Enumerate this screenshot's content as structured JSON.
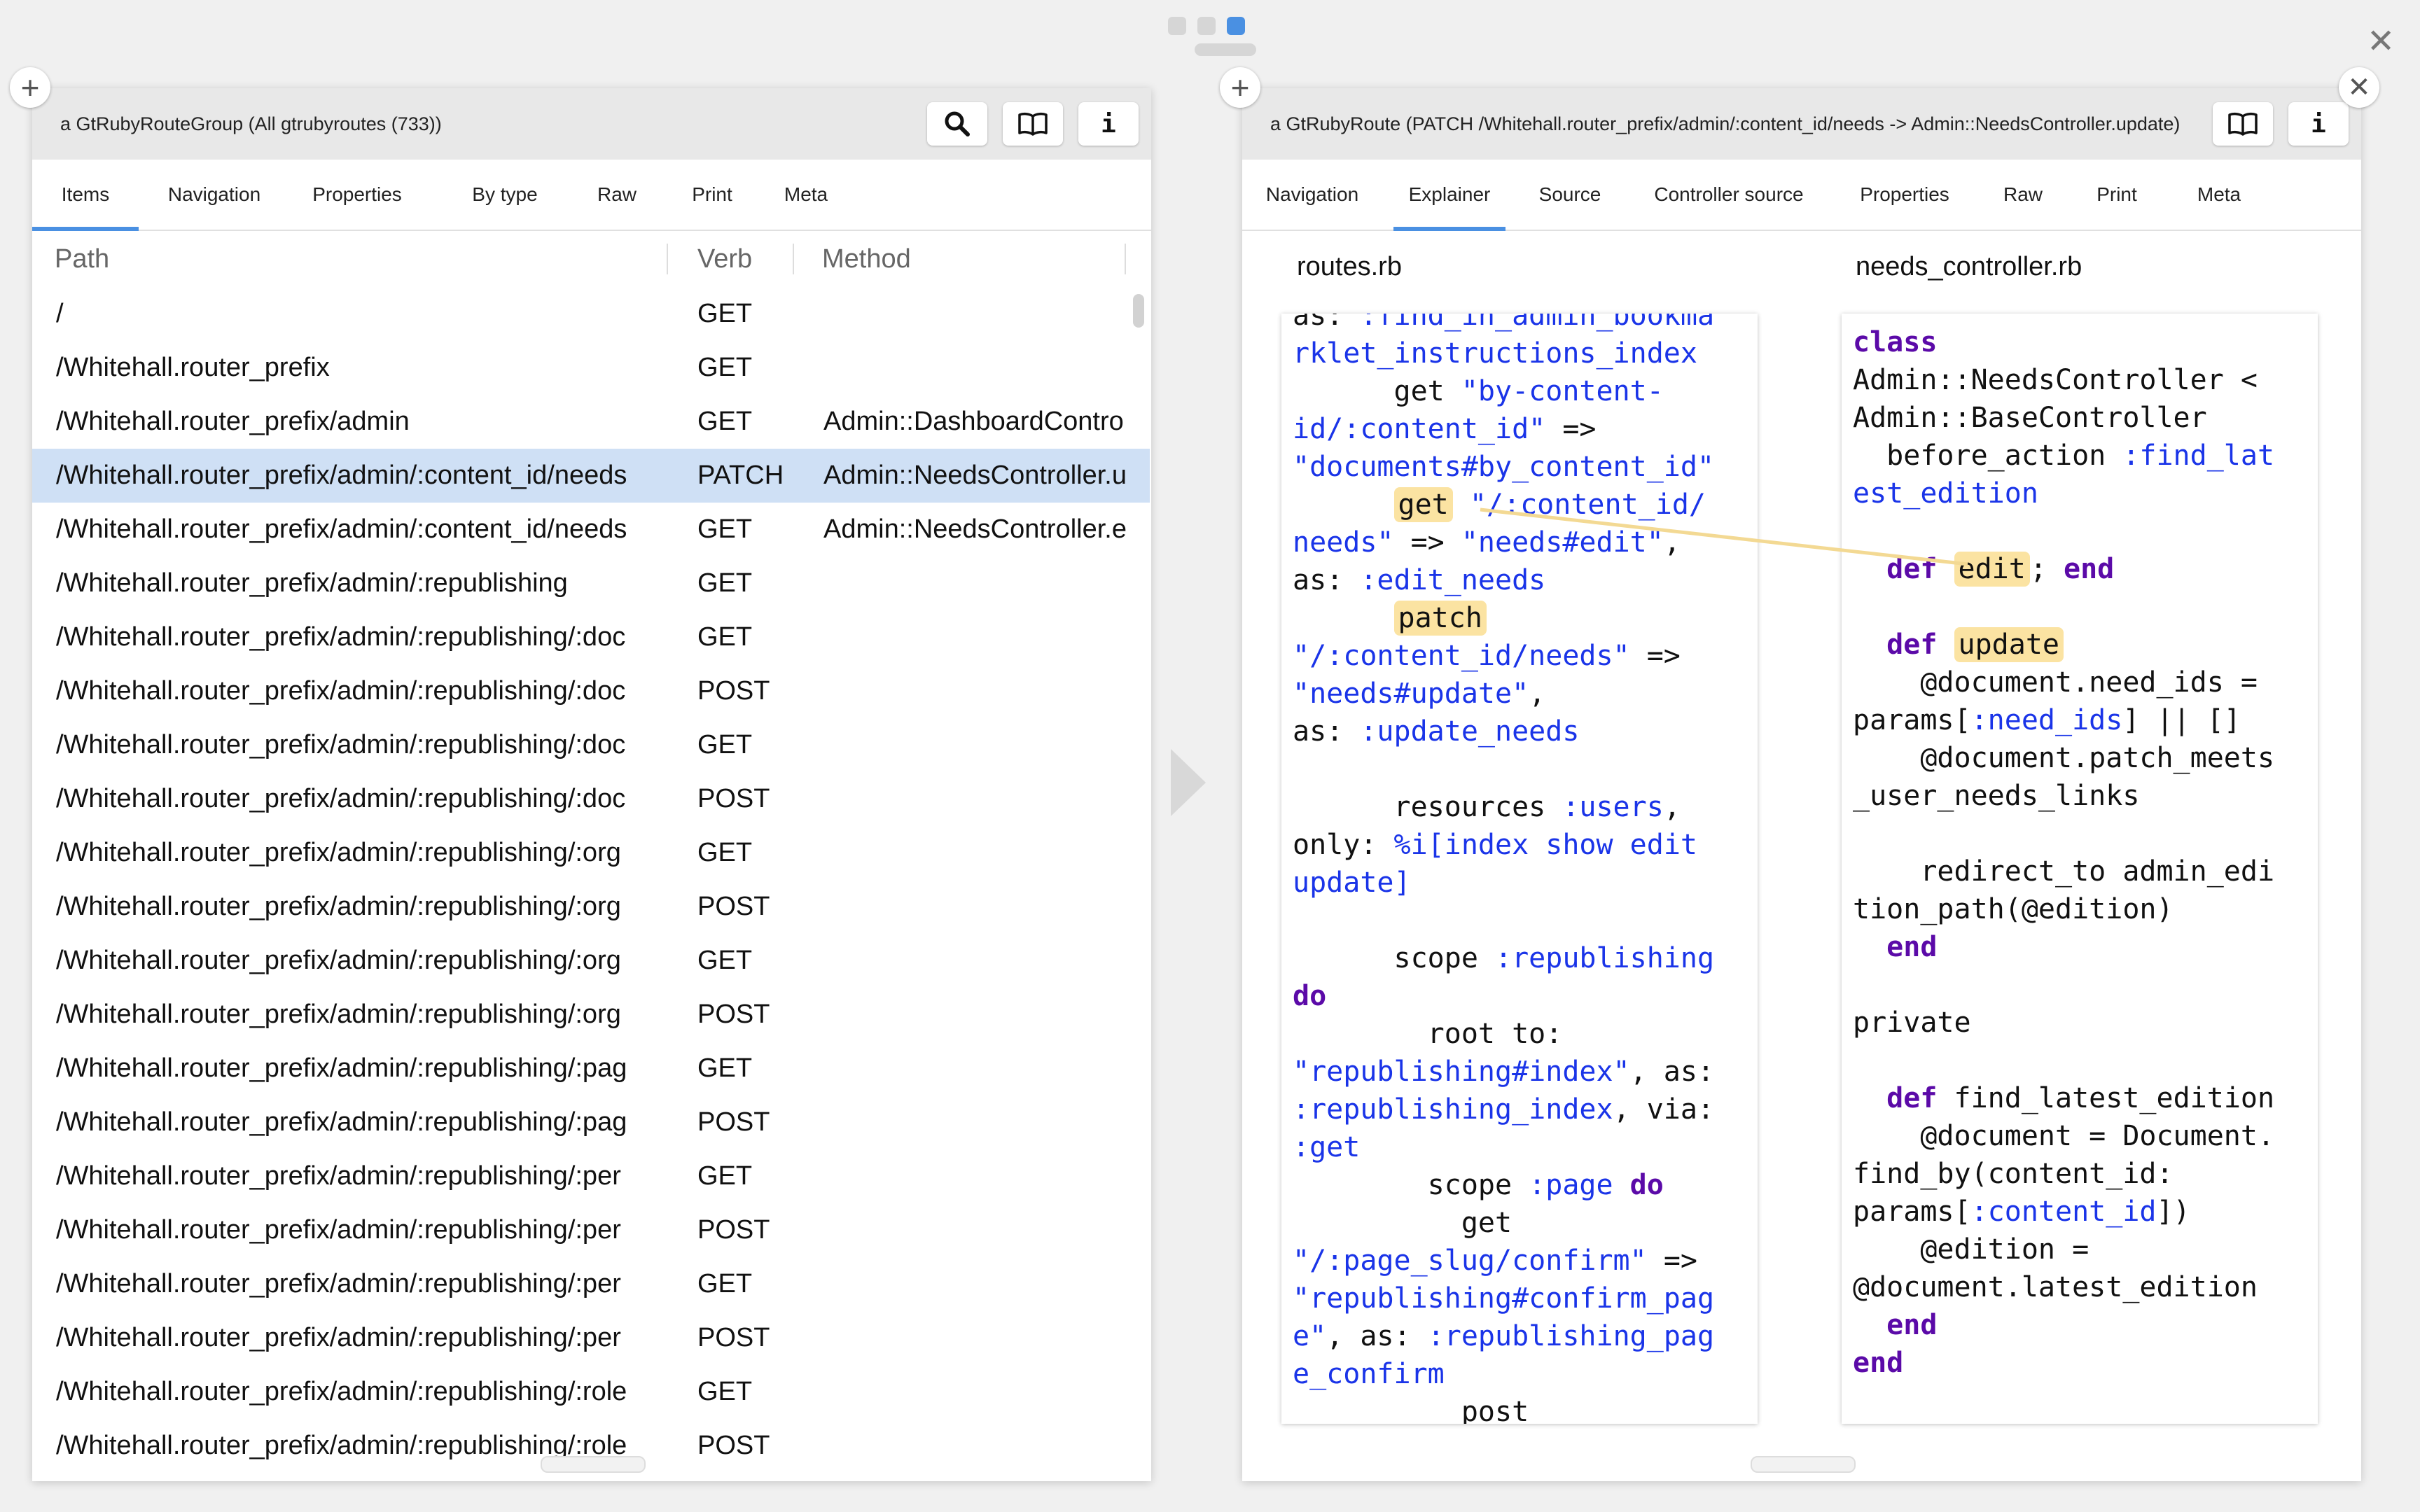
{
  "window_dots": [
    "dot-1",
    "dot-2",
    "dot-3"
  ],
  "left_pane": {
    "title": "a GtRubyRouteGroup (All gtrubyroutes (733))",
    "tabs": [
      "Items",
      "Navigation",
      "Properties",
      "By type",
      "Raw",
      "Print",
      "Meta"
    ],
    "active_tab": "Items",
    "columns": [
      "Path",
      "Verb",
      "Method"
    ],
    "rows": [
      {
        "path": "/",
        "verb": "GET",
        "method": ""
      },
      {
        "path": "/Whitehall.router_prefix",
        "verb": "GET",
        "method": ""
      },
      {
        "path": "/Whitehall.router_prefix/admin",
        "verb": "GET",
        "method": "Admin::DashboardContro"
      },
      {
        "path": "/Whitehall.router_prefix/admin/:content_id/needs",
        "verb": "PATCH",
        "method": "Admin::NeedsController.u"
      },
      {
        "path": "/Whitehall.router_prefix/admin/:content_id/needs",
        "verb": "GET",
        "method": "Admin::NeedsController.e"
      },
      {
        "path": "/Whitehall.router_prefix/admin/:republishing",
        "verb": "GET",
        "method": ""
      },
      {
        "path": "/Whitehall.router_prefix/admin/:republishing/:doc",
        "verb": "GET",
        "method": ""
      },
      {
        "path": "/Whitehall.router_prefix/admin/:republishing/:doc",
        "verb": "POST",
        "method": ""
      },
      {
        "path": "/Whitehall.router_prefix/admin/:republishing/:doc",
        "verb": "GET",
        "method": ""
      },
      {
        "path": "/Whitehall.router_prefix/admin/:republishing/:doc",
        "verb": "POST",
        "method": ""
      },
      {
        "path": "/Whitehall.router_prefix/admin/:republishing/:org",
        "verb": "GET",
        "method": ""
      },
      {
        "path": "/Whitehall.router_prefix/admin/:republishing/:org",
        "verb": "POST",
        "method": ""
      },
      {
        "path": "/Whitehall.router_prefix/admin/:republishing/:org",
        "verb": "GET",
        "method": ""
      },
      {
        "path": "/Whitehall.router_prefix/admin/:republishing/:org",
        "verb": "POST",
        "method": ""
      },
      {
        "path": "/Whitehall.router_prefix/admin/:republishing/:pag",
        "verb": "GET",
        "method": ""
      },
      {
        "path": "/Whitehall.router_prefix/admin/:republishing/:pag",
        "verb": "POST",
        "method": ""
      },
      {
        "path": "/Whitehall.router_prefix/admin/:republishing/:per",
        "verb": "GET",
        "method": ""
      },
      {
        "path": "/Whitehall.router_prefix/admin/:republishing/:per",
        "verb": "POST",
        "method": ""
      },
      {
        "path": "/Whitehall.router_prefix/admin/:republishing/:per",
        "verb": "GET",
        "method": ""
      },
      {
        "path": "/Whitehall.router_prefix/admin/:republishing/:per",
        "verb": "POST",
        "method": ""
      },
      {
        "path": "/Whitehall.router_prefix/admin/:republishing/:role",
        "verb": "GET",
        "method": ""
      },
      {
        "path": "/Whitehall.router_prefix/admin/:republishing/:role",
        "verb": "POST",
        "method": ""
      }
    ]
  },
  "right_pane": {
    "title": "a GtRubyRoute (PATCH /Whitehall.router_prefix/admin/:content_id/needs -> Admin::NeedsController.update)",
    "tabs": [
      "Navigation",
      "Explainer",
      "Source",
      "Controller source",
      "Properties",
      "Raw",
      "Print",
      "Meta"
    ],
    "active_tab": "Explainer",
    "routes_label": "routes.rb",
    "controller_label": "needs_controller.rb"
  },
  "colors": {
    "selection": "#cfe0f5",
    "tab_underline": "#4a90e2",
    "keyword": "#5b0aa8",
    "symbol": "#1a34e8",
    "highlight": "#fbe3a2",
    "link_line": "#f3d993"
  }
}
